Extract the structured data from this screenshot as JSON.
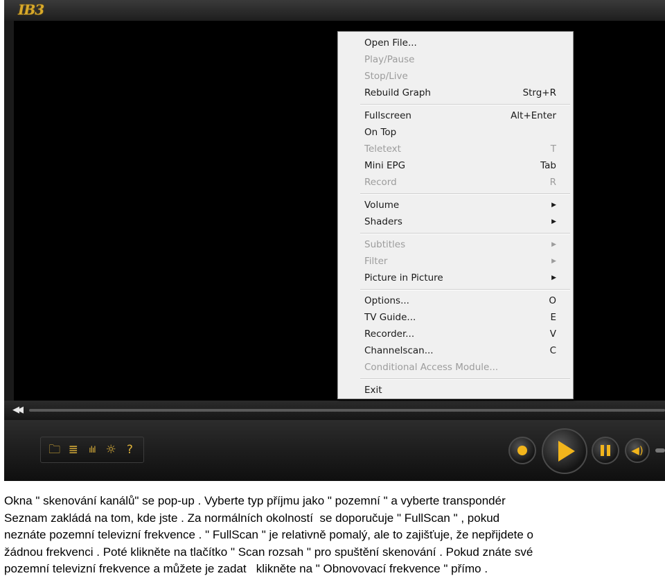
{
  "player": {
    "logo_text": "IB3",
    "toolbar": [
      {
        "name": "folder-icon",
        "glyph": "🗀"
      },
      {
        "name": "playlist-icon",
        "glyph": "≣"
      },
      {
        "name": "equalizer-icon",
        "glyph": "ılıl"
      },
      {
        "name": "settings-icon",
        "glyph": "☼"
      },
      {
        "name": "help-icon",
        "glyph": "?"
      }
    ],
    "colors": {
      "accent": "#f2b51c",
      "background": "#1a1a1a",
      "video": "#000000"
    }
  },
  "menu": {
    "items": [
      {
        "label": "Open File...",
        "shortcut": "",
        "disabled": false,
        "submenu": false
      },
      {
        "label": "Play/Pause",
        "shortcut": "",
        "disabled": true,
        "submenu": false
      },
      {
        "label": "Stop/Live",
        "shortcut": "",
        "disabled": true,
        "submenu": false
      },
      {
        "label": "Rebuild Graph",
        "shortcut": "Strg+R",
        "disabled": false,
        "submenu": false
      },
      {
        "separator": true
      },
      {
        "label": "Fullscreen",
        "shortcut": "Alt+Enter",
        "disabled": false,
        "submenu": false
      },
      {
        "label": "On Top",
        "shortcut": "",
        "disabled": false,
        "submenu": false
      },
      {
        "label": "Teletext",
        "shortcut": "T",
        "disabled": true,
        "submenu": false
      },
      {
        "label": "Mini EPG",
        "shortcut": "Tab",
        "disabled": false,
        "submenu": false
      },
      {
        "label": "Record",
        "shortcut": "R",
        "disabled": true,
        "submenu": false
      },
      {
        "separator": true
      },
      {
        "label": "Volume",
        "shortcut": "",
        "disabled": false,
        "submenu": true
      },
      {
        "label": "Shaders",
        "shortcut": "",
        "disabled": false,
        "submenu": true
      },
      {
        "separator": true
      },
      {
        "label": "Subtitles",
        "shortcut": "",
        "disabled": true,
        "submenu": true
      },
      {
        "label": "Filter",
        "shortcut": "",
        "disabled": true,
        "submenu": true
      },
      {
        "label": "Picture in Picture",
        "shortcut": "",
        "disabled": false,
        "submenu": true
      },
      {
        "separator": true
      },
      {
        "label": "Options...",
        "shortcut": "O",
        "disabled": false,
        "submenu": false
      },
      {
        "label": "TV Guide...",
        "shortcut": "E",
        "disabled": false,
        "submenu": false
      },
      {
        "label": "Recorder...",
        "shortcut": "V",
        "disabled": false,
        "submenu": false
      },
      {
        "label": "Channelscan...",
        "shortcut": "C",
        "disabled": false,
        "submenu": false
      },
      {
        "label": "Conditional Access Module...",
        "shortcut": "",
        "disabled": true,
        "submenu": false
      },
      {
        "separator": true
      },
      {
        "label": "Exit",
        "shortcut": "",
        "disabled": false,
        "submenu": false
      }
    ]
  },
  "caption": {
    "lines": [
      "Okna \" skenování kanálů\" se pop-up . Vyberte typ příjmu jako \" pozemní \" a vyberte transpondér",
      "Seznam zakládá na tom, kde jste . Za normálních okolností  se doporučuje \" FullScan \" , pokud",
      "neznáte pozemní televizní frekvence . \" FullScan \" je relativně pomalý, ale to zajišťuje, že nepřijdete o",
      "žádnou frekvenci . Poté klikněte na tlačítko \" Scan rozsah \" pro spuštění skenování . Pokud znáte své",
      "pozemní televizní frekvence a můžete je zadat   klikněte na \" Obnovovací frekvence \" přímo ."
    ]
  }
}
